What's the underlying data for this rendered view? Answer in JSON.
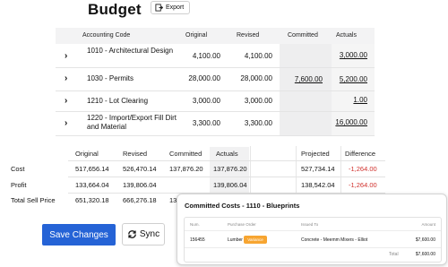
{
  "header": {
    "title": "Budget",
    "export_label": "Export"
  },
  "budget_table": {
    "columns": [
      "Accounting Code",
      "Original",
      "Revised",
      "Committed",
      "Actuals"
    ],
    "rows": [
      {
        "code": "1010 - Architectural Design",
        "original": "4,100.00",
        "revised": "4,100.00",
        "committed": "",
        "actuals": "3,000.00"
      },
      {
        "code": "1030 - Permits",
        "original": "28,000.00",
        "revised": "28,000.00",
        "committed": "7,600.00",
        "actuals": "5,200.00"
      },
      {
        "code": "1210 - Lot Clearing",
        "original": "3,000.00",
        "revised": "3,000.00",
        "committed": "",
        "actuals": "1.00"
      },
      {
        "code": "1220 - Import/Export Fill Dirt and Material",
        "original": "3,300.00",
        "revised": "3,300.00",
        "committed": "",
        "actuals": "16,000.00"
      }
    ]
  },
  "summary_table": {
    "columns": [
      "Original",
      "Revised",
      "Committed",
      "Actuals",
      "Projected",
      "Difference"
    ],
    "rows": [
      {
        "label": "Cost",
        "original": "517,656.14",
        "revised": "526,470.14",
        "committed": "137,876.20",
        "actuals": "137,876.20",
        "projected": "527,734.14",
        "difference": "-1,264.00"
      },
      {
        "label": "Profit",
        "original": "133,664.04",
        "revised": "139,806.04",
        "committed": "",
        "actuals": "139,806.04",
        "projected": "138,542.04",
        "difference": "-1,264.00"
      },
      {
        "label": "Total Sell Price",
        "original": "651,320.18",
        "revised": "666,276.18",
        "committed": "137,876.20",
        "actuals": "",
        "projected": "",
        "difference": ""
      }
    ]
  },
  "actions": {
    "save_label": "Save Changes",
    "sync_label": "Sync"
  },
  "popup": {
    "title": "Committed Costs - 1110 - Blueprints",
    "columns": [
      "Num.",
      "Purchase Order",
      "Issued To",
      "Amount"
    ],
    "row": {
      "num": "156455",
      "po": "Lumber",
      "badge": "Variance",
      "issued_to": "Concrete - Meemm Mixers - Elliot",
      "amount": "$7,600.00"
    },
    "total_label": "Total",
    "total_value": "$7,600.00"
  },
  "colors": {
    "accent": "#2563d6",
    "negative": "#d0312d",
    "badge": "#f7a531"
  },
  "icons": {
    "export": "export-icon",
    "sync": "sync-icon",
    "expand": "chevron-right-icon"
  }
}
